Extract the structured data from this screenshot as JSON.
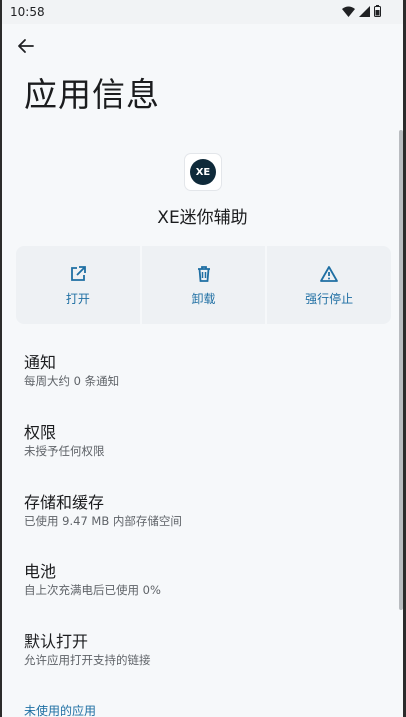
{
  "status": {
    "time": "10:58"
  },
  "header": {
    "title": "应用信息"
  },
  "app": {
    "name": "XE迷你辅助",
    "icon_text": "XE"
  },
  "actions": [
    {
      "label": "打开",
      "icon": "open-external-icon"
    },
    {
      "label": "卸载",
      "icon": "trash-icon"
    },
    {
      "label": "强行停止",
      "icon": "warning-icon"
    }
  ],
  "items": [
    {
      "title": "通知",
      "subtitle": "每周大约 0 条通知"
    },
    {
      "title": "权限",
      "subtitle": "未授予任何权限"
    },
    {
      "title": "存储和缓存",
      "subtitle": "已使用 9.47 MB 内部存储空间"
    },
    {
      "title": "电池",
      "subtitle": "自上次充满电后已使用 0%"
    },
    {
      "title": "默认打开",
      "subtitle": "允许应用打开支持的链接"
    }
  ],
  "section": {
    "unused_apps": "未使用的应用"
  },
  "colors": {
    "accent": "#1f6fa3",
    "background": "#f6f8fa",
    "action_bg": "#eef1f4"
  }
}
